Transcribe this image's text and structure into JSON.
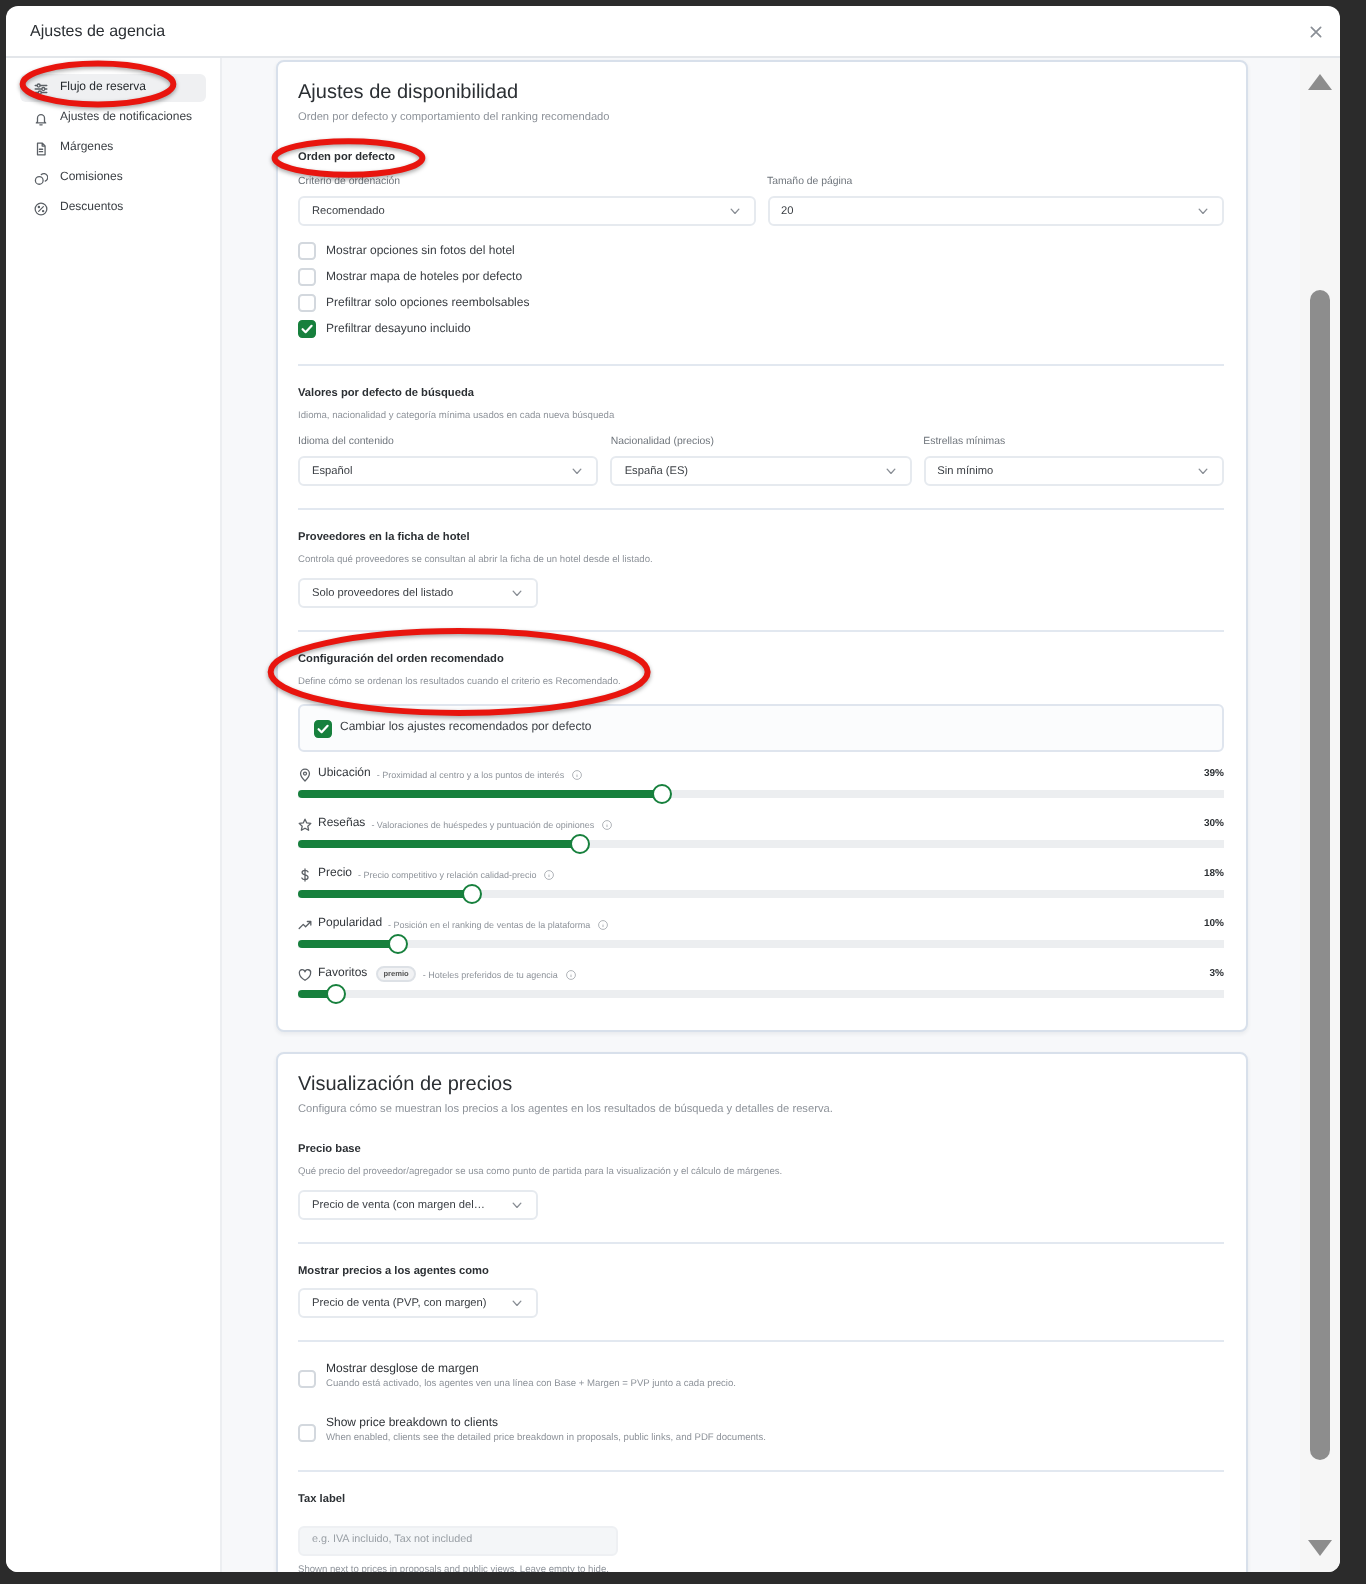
{
  "window": {
    "title": "Ajustes de agencia"
  },
  "sidebar": {
    "items": [
      {
        "label": "Flujo de reserva",
        "selected": true,
        "circled": true
      },
      {
        "label": "Ajustes de notificaciones",
        "selected": false,
        "circled": false
      },
      {
        "label": "Márgenes",
        "selected": false,
        "circled": false
      },
      {
        "label": "Comisiones",
        "selected": false,
        "circled": false
      },
      {
        "label": "Descuentos",
        "selected": false,
        "circled": false
      }
    ]
  },
  "availability": {
    "title": "Ajustes de disponibilidad",
    "subtitle": "Orden por defecto y comportamiento del ranking recomendado",
    "sections": [
      {
        "heading": "Orden por defecto",
        "circled": true,
        "fields": [
          {
            "label": "Criterio de ordenación",
            "value": "Recomendado"
          },
          {
            "label": "Tamaño de página",
            "value": "20"
          }
        ],
        "options": [
          {
            "label": "Mostrar opciones sin fotos del hotel",
            "checked": false
          },
          {
            "label": "Mostrar mapa de hoteles por defecto",
            "checked": false
          },
          {
            "label": "Prefiltrar solo opciones reembolsables",
            "checked": false
          },
          {
            "label": "Prefiltrar desayuno incluido",
            "checked": true
          }
        ]
      },
      {
        "heading": "Valores por defecto de búsqueda",
        "circled": false,
        "description": "Idioma, nacionalidad y categoría mínima usados en cada nueva búsqueda",
        "fields": [
          {
            "label": "Idioma del contenido",
            "value": "Español"
          },
          {
            "label": "Nacionalidad (precios)",
            "value": "España (ES)"
          },
          {
            "label": "Estrellas mínimas",
            "value": "Sin mínimo"
          }
        ]
      },
      {
        "heading": "Proveedores en la ficha de hotel",
        "circled": false,
        "description": "Controla qué proveedores se consultan al abrir la ficha de un hotel desde el listado.",
        "fields": [
          {
            "value": "Solo proveedores del listado"
          }
        ]
      },
      {
        "heading": "Configuración del orden recomendado",
        "circled": true,
        "description": "Define cómo se ordenan los resultados cuando el criterio es Recomendado.",
        "override": {
          "label": "Cambiar los ajustes recomendados por defecto",
          "checked": true
        },
        "weights": [
          {
            "name": "Ubicación",
            "description": "- Proximidad al centro y a los puntos de interés",
            "reading": "39%",
            "level": 0.39
          },
          {
            "name": "Reseñas",
            "description": "- Valoraciones de huéspedes y puntuación de opiniones",
            "reading": "30%",
            "level": 0.3
          },
          {
            "name": "Precio",
            "description": "- Precio competitivo y relación calidad-precio",
            "reading": "18%",
            "level": 0.18
          },
          {
            "name": "Popularidad",
            "description": "- Posición en el ranking de ventas de la plataforma",
            "reading": "10%",
            "level": 0.1
          },
          {
            "name": "Favoritos",
            "badge": "premio",
            "description": "- Hoteles preferidos de tu agencia",
            "reading": "3%",
            "level": 0.03
          }
        ]
      }
    ]
  },
  "pricing": {
    "title": "Visualización de precios",
    "subtitle": "Configura cómo se muestran los precios a los agentes en los resultados de búsqueda y detalles de reserva.",
    "sections": [
      {
        "heading": "Precio base",
        "circled": false,
        "description": "Qué precio del proveedor/agregador se usa como punto de partida para la visualización y el cálculo de márgenes.",
        "fields": [
          {
            "value": "Precio de venta (con margen del…"
          }
        ]
      },
      {
        "heading": "Mostrar precios a los agentes como",
        "circled": false,
        "fields": [
          {
            "value": "Precio de venta (PVP, con margen)"
          }
        ]
      },
      {
        "circled": false,
        "options": [
          {
            "label": "Mostrar desglose de margen",
            "description": "Cuando está activado, los agentes ven una línea con Base + Margen = PVP junto a cada precio.",
            "checked": false
          },
          {
            "label": "Show price breakdown to clients",
            "description": "When enabled, clients see the detailed price breakdown in proposals, public links, and PDF documents.",
            "checked": false
          }
        ]
      },
      {
        "heading": "Tax label",
        "circled": false,
        "fields": [
          {
            "placeholder": "e.g. IVA incluido, Tax not included"
          }
        ],
        "help": "Shown next to prices in proposals and public views. Leave empty to hide."
      }
    ]
  }
}
